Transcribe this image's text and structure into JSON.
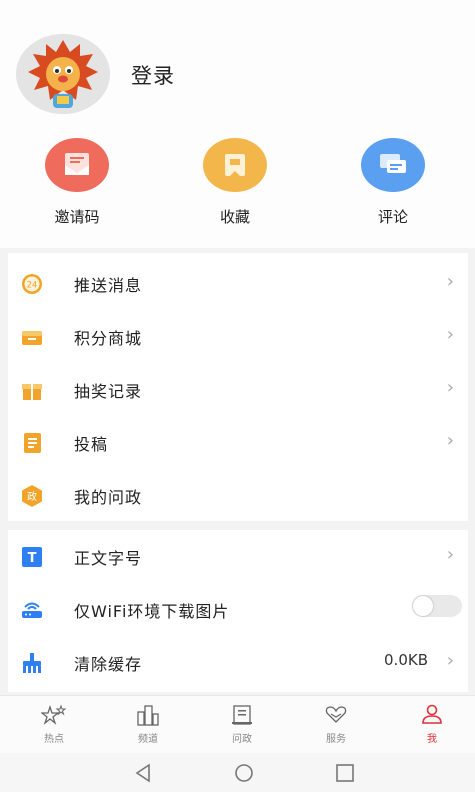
{
  "header": {
    "login_label": "登录"
  },
  "quick_actions": [
    {
      "label": "邀请码",
      "icon": "envelope-icon",
      "color": "#ef6b5c"
    },
    {
      "label": "收藏",
      "icon": "bookmark-icon",
      "color": "#f3b64a"
    },
    {
      "label": "评论",
      "icon": "chat-bubble-icon",
      "color": "#5a9ff0"
    }
  ],
  "menu_group1": [
    {
      "label": "推送消息",
      "icon": "push-24-icon",
      "chevron": true
    },
    {
      "label": "积分商城",
      "icon": "store-icon",
      "chevron": true
    },
    {
      "label": "抽奖记录",
      "icon": "gift-icon",
      "chevron": true
    },
    {
      "label": "投稿",
      "icon": "document-icon",
      "chevron": true
    },
    {
      "label": "我的问政",
      "icon": "politics-icon",
      "chevron": false
    }
  ],
  "menu_group2": [
    {
      "label": "正文字号",
      "icon": "font-size-icon",
      "chevron": true
    },
    {
      "label": "仅WiFi环境下载图片",
      "icon": "wifi-router-icon",
      "toggle": false
    },
    {
      "label": "清除缓存",
      "icon": "broom-icon",
      "value": "0.0KB",
      "chevron": true
    }
  ],
  "icon_badge_text": "24",
  "icon_politics_text": "政",
  "icon_font_text": "T",
  "tabs": [
    {
      "label": "热点",
      "icon": "stars-icon",
      "active": false
    },
    {
      "label": "频道",
      "icon": "buildings-icon",
      "active": false
    },
    {
      "label": "问政",
      "icon": "notebook-icon",
      "active": false
    },
    {
      "label": "服务",
      "icon": "heart-hands-icon",
      "active": false
    },
    {
      "label": "我",
      "icon": "person-icon",
      "active": true
    }
  ],
  "colors": {
    "accent": "#e0303a",
    "orange": "#f2a32a",
    "blue": "#2d7ff2"
  }
}
